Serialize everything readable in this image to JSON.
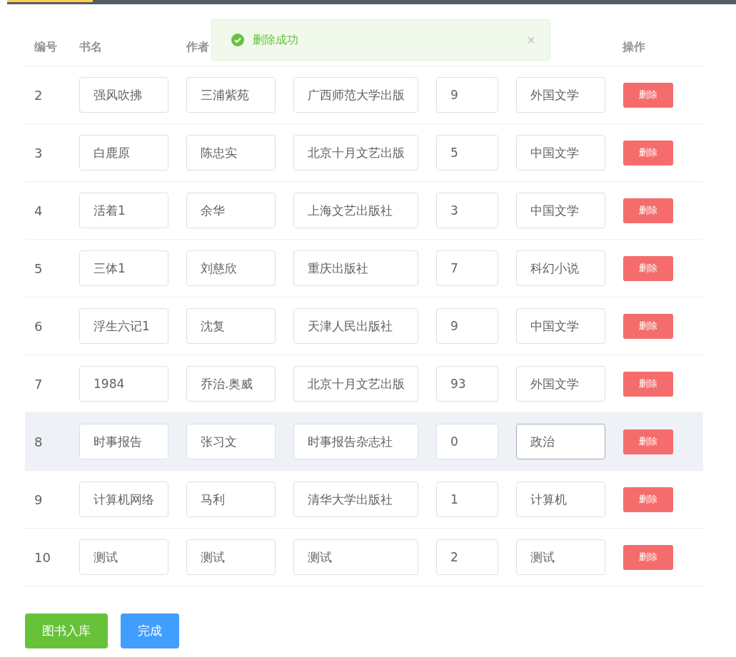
{
  "toast": {
    "message": "删除成功",
    "close": "×"
  },
  "table": {
    "columns": [
      "编号",
      "书名",
      "作者"
    ],
    "action_column": "操作",
    "rows": [
      {
        "id": "2",
        "fields": [
          {
            "value": "强风吹拂",
            "focused": false
          },
          {
            "value": "三浦紫苑",
            "focused": false
          },
          {
            "value": "广西师范大学出版",
            "focused": false
          },
          {
            "value": "9",
            "focused": false
          },
          {
            "value": "外国文学",
            "focused": false
          }
        ],
        "action": "删除",
        "highlighted": false
      },
      {
        "id": "3",
        "fields": [
          {
            "value": "白鹿原",
            "focused": false
          },
          {
            "value": "陈忠实",
            "focused": false
          },
          {
            "value": "北京十月文艺出版",
            "focused": false
          },
          {
            "value": "5",
            "focused": false
          },
          {
            "value": "中国文学",
            "focused": false
          }
        ],
        "action": "删除",
        "highlighted": false
      },
      {
        "id": "4",
        "fields": [
          {
            "value": "活着1",
            "focused": false
          },
          {
            "value": "余华",
            "focused": false
          },
          {
            "value": "上海文艺出版社",
            "focused": false
          },
          {
            "value": "3",
            "focused": false
          },
          {
            "value": "中国文学",
            "focused": false
          }
        ],
        "action": "删除",
        "highlighted": false
      },
      {
        "id": "5",
        "fields": [
          {
            "value": "三体1",
            "focused": false
          },
          {
            "value": "刘慈欣",
            "focused": false
          },
          {
            "value": "重庆出版社",
            "focused": false
          },
          {
            "value": "7",
            "focused": false
          },
          {
            "value": "科幻小说",
            "focused": false
          }
        ],
        "action": "删除",
        "highlighted": false
      },
      {
        "id": "6",
        "fields": [
          {
            "value": "浮生六记1",
            "focused": false
          },
          {
            "value": "沈复",
            "focused": false
          },
          {
            "value": "天津人民出版社",
            "focused": false
          },
          {
            "value": "9",
            "focused": false
          },
          {
            "value": "中国文学",
            "focused": false
          }
        ],
        "action": "删除",
        "highlighted": false
      },
      {
        "id": "7",
        "fields": [
          {
            "value": "1984",
            "focused": false
          },
          {
            "value": "乔治.奥威",
            "focused": false
          },
          {
            "value": "北京十月文艺出版",
            "focused": false
          },
          {
            "value": "93",
            "focused": false
          },
          {
            "value": "外国文学",
            "focused": false
          }
        ],
        "action": "删除",
        "highlighted": false
      },
      {
        "id": "8",
        "fields": [
          {
            "value": "时事报告",
            "focused": false
          },
          {
            "value": "张习文",
            "focused": false
          },
          {
            "value": "时事报告杂志社",
            "focused": false
          },
          {
            "value": "0",
            "focused": false
          },
          {
            "value": "政治",
            "focused": true
          }
        ],
        "action": "删除",
        "highlighted": true
      },
      {
        "id": "9",
        "fields": [
          {
            "value": "计算机网络",
            "focused": false
          },
          {
            "value": "马利",
            "focused": false
          },
          {
            "value": "清华大学出版社",
            "focused": false
          },
          {
            "value": "1",
            "focused": false
          },
          {
            "value": "计算机",
            "focused": false
          }
        ],
        "action": "删除",
        "highlighted": false
      },
      {
        "id": "10",
        "fields": [
          {
            "value": "测试",
            "focused": false
          },
          {
            "value": "测试",
            "focused": false
          },
          {
            "value": "测试",
            "focused": false
          },
          {
            "value": "2",
            "focused": false
          },
          {
            "value": "测试",
            "focused": false
          }
        ],
        "action": "删除",
        "highlighted": false
      }
    ]
  },
  "buttons": [
    {
      "label": "图书入库",
      "kind": "success"
    },
    {
      "label": "完成",
      "kind": "primary"
    }
  ]
}
